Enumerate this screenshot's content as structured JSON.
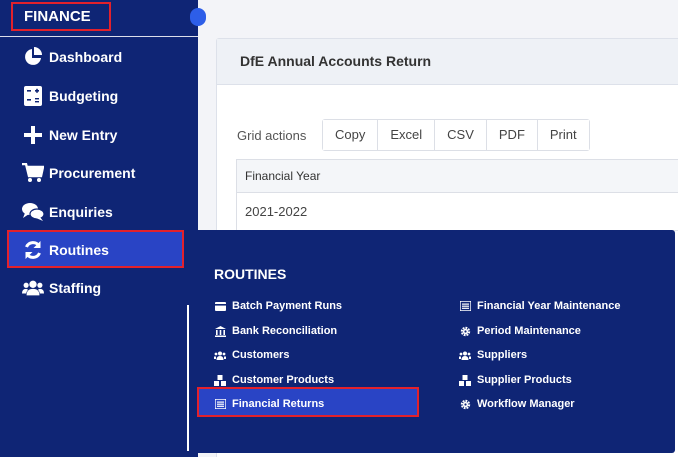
{
  "sidebar": {
    "header": "FINANCE",
    "items": [
      {
        "label": "Dashboard",
        "icon": "pie-chart-icon"
      },
      {
        "label": "Budgeting",
        "icon": "calculator-icon"
      },
      {
        "label": "New Entry",
        "icon": "plus-icon"
      },
      {
        "label": "Procurement",
        "icon": "cart-icon"
      },
      {
        "label": "Enquiries",
        "icon": "chat-icon"
      },
      {
        "label": "Routines",
        "icon": "refresh-icon"
      },
      {
        "label": "Staffing",
        "icon": "users-icon"
      }
    ]
  },
  "main": {
    "title": "DfE Annual Accounts Return",
    "grid_actions_label": "Grid actions",
    "buttons": [
      "Copy",
      "Excel",
      "CSV",
      "PDF",
      "Print"
    ],
    "table": {
      "header": "Financial Year",
      "rows": [
        "2021-2022"
      ]
    }
  },
  "flyout": {
    "title": "ROUTINES",
    "left": [
      {
        "label": "Batch Payment Runs",
        "icon": "card-icon"
      },
      {
        "label": "Bank Reconciliation",
        "icon": "bank-icon"
      },
      {
        "label": "Customers",
        "icon": "users-icon"
      },
      {
        "label": "Customer Products",
        "icon": "cubes-icon"
      },
      {
        "label": "Financial Returns",
        "icon": "list-icon"
      }
    ],
    "right": [
      {
        "label": "Financial Year Maintenance",
        "icon": "list-icon"
      },
      {
        "label": "Period Maintenance",
        "icon": "gear-icon"
      },
      {
        "label": "Suppliers",
        "icon": "users-icon"
      },
      {
        "label": "Supplier Products",
        "icon": "cubes-icon"
      },
      {
        "label": "Workflow Manager",
        "icon": "gear-icon"
      }
    ]
  },
  "colors": {
    "sidebar_bg": "#0f2575",
    "active_bg": "#2944c5",
    "highlight_border": "#e3212b"
  }
}
